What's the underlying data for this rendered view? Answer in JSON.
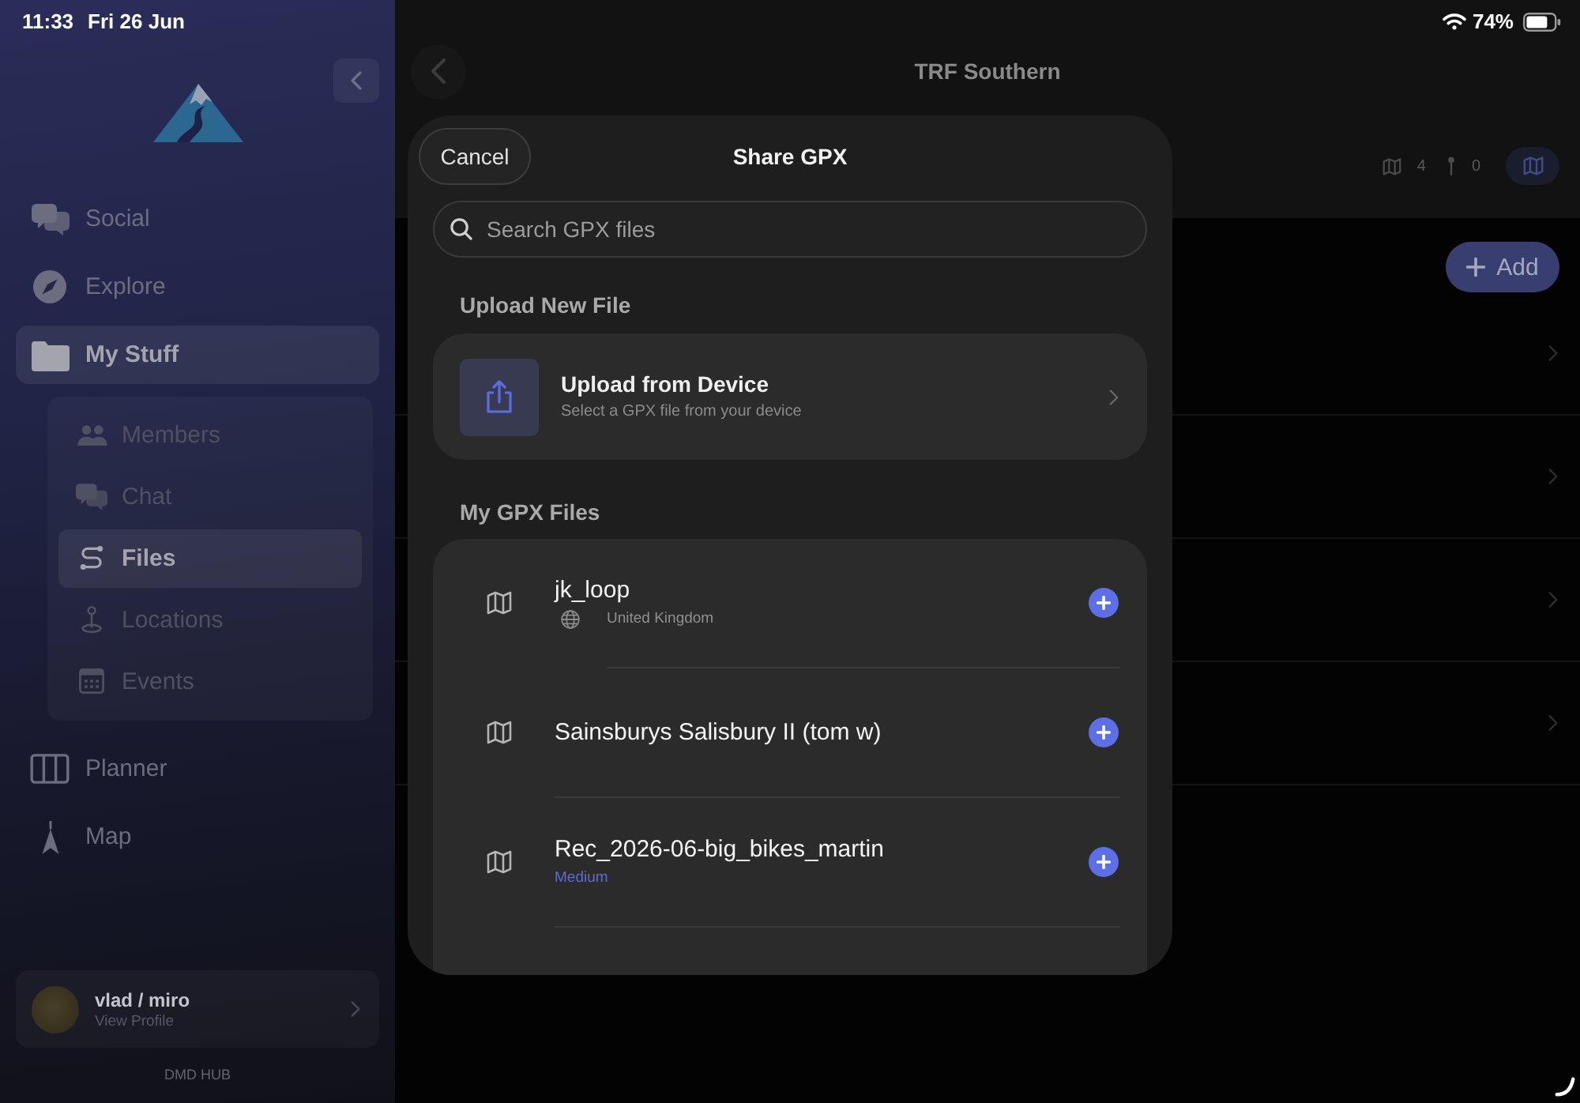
{
  "status_bar": {
    "time": "11:33",
    "date": "Fri 26 Jun",
    "battery": "74%"
  },
  "sidebar": {
    "items": [
      {
        "label": "Social",
        "selected": false
      },
      {
        "label": "Explore",
        "selected": false
      },
      {
        "label": "My Stuff",
        "selected": true,
        "children": [
          {
            "label": "Members",
            "selected": false
          },
          {
            "label": "Chat",
            "selected": false
          },
          {
            "label": "Files",
            "selected": true
          },
          {
            "label": "Locations",
            "selected": false
          },
          {
            "label": "Events",
            "selected": false
          }
        ]
      },
      {
        "label": "Planner",
        "selected": false
      },
      {
        "label": "Map",
        "selected": false
      }
    ],
    "profile": {
      "name": "vlad / miro",
      "subtitle": "View Profile"
    },
    "footer": "DMD HUB"
  },
  "page": {
    "title": "TRF Southern",
    "stats": [
      {
        "value": "4"
      },
      {
        "value": "0"
      }
    ],
    "map_view": {
      "selected": true
    },
    "add_button": "Add",
    "rows": [
      {
        "kind": "link"
      },
      {
        "kind": "link"
      },
      {
        "kind": "link"
      },
      {
        "kind": "link"
      }
    ]
  },
  "dialog": {
    "cancel": "Cancel",
    "title": "Share GPX",
    "search": {
      "placeholder": "Search GPX files"
    },
    "upload_section": {
      "heading": "Upload New File",
      "title": "Upload from Device",
      "subtitle": "Select a GPX file from your device"
    },
    "files_section": {
      "heading": "My GPX Files",
      "files": [
        {
          "name": "jk_loop",
          "kind": "region",
          "detail": "United Kingdom"
        },
        {
          "name": "Sainsburys Salisbury II (tom w)",
          "kind": "plain"
        },
        {
          "name": "Rec_2026-06-big_bikes_martin",
          "kind": "difficulty",
          "detail": "Medium"
        }
      ]
    }
  }
}
